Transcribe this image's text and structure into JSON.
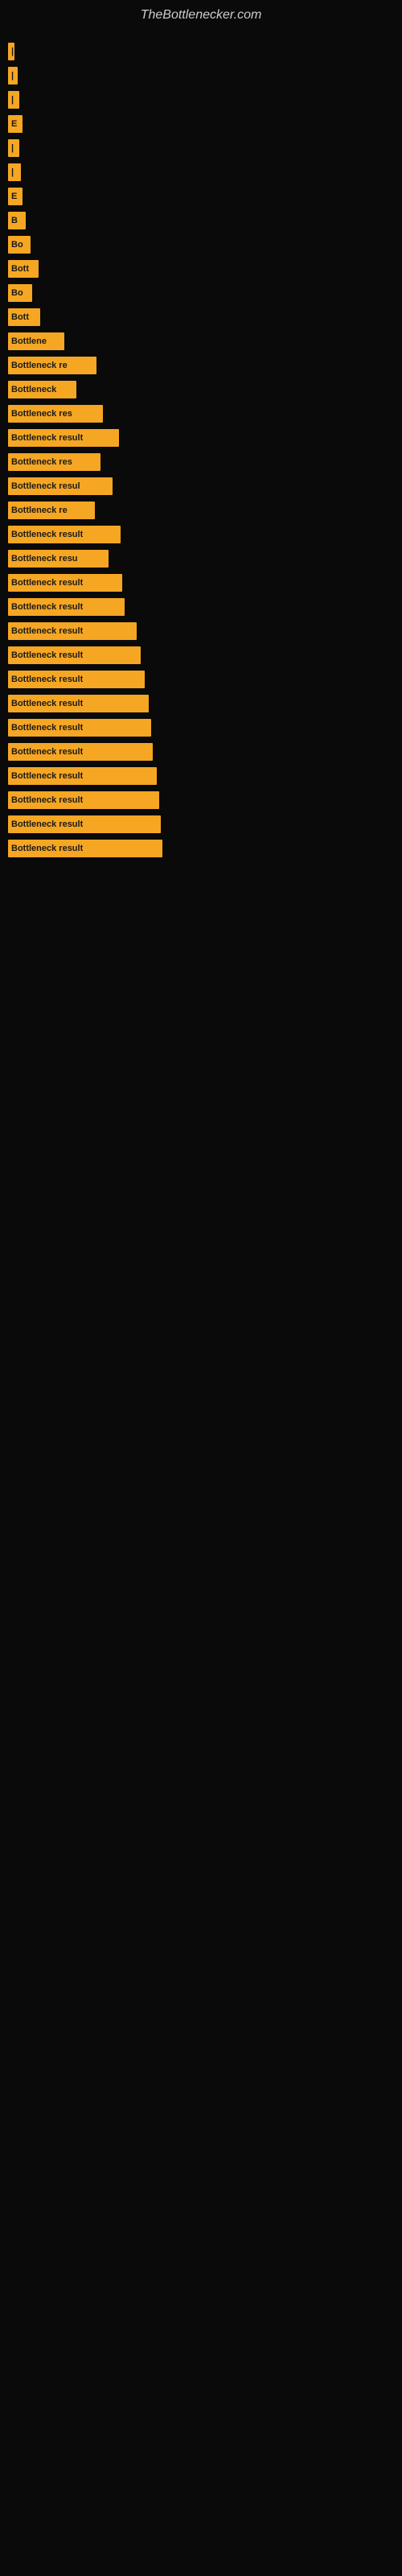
{
  "site": {
    "title": "TheBottlenecker.com"
  },
  "bars": [
    {
      "label": "|",
      "width": 8
    },
    {
      "label": "|",
      "width": 12
    },
    {
      "label": "|",
      "width": 14
    },
    {
      "label": "E",
      "width": 18
    },
    {
      "label": "|",
      "width": 14
    },
    {
      "label": "|",
      "width": 16
    },
    {
      "label": "E",
      "width": 18
    },
    {
      "label": "B",
      "width": 22
    },
    {
      "label": "Bo",
      "width": 28
    },
    {
      "label": "Bott",
      "width": 38
    },
    {
      "label": "Bo",
      "width": 30
    },
    {
      "label": "Bott",
      "width": 40
    },
    {
      "label": "Bottlene",
      "width": 70
    },
    {
      "label": "Bottleneck re",
      "width": 110
    },
    {
      "label": "Bottleneck",
      "width": 85
    },
    {
      "label": "Bottleneck res",
      "width": 118
    },
    {
      "label": "Bottleneck result",
      "width": 138
    },
    {
      "label": "Bottleneck res",
      "width": 115
    },
    {
      "label": "Bottleneck resul",
      "width": 130
    },
    {
      "label": "Bottleneck re",
      "width": 108
    },
    {
      "label": "Bottleneck result",
      "width": 140
    },
    {
      "label": "Bottleneck resu",
      "width": 125
    },
    {
      "label": "Bottleneck result",
      "width": 142
    },
    {
      "label": "Bottleneck result",
      "width": 145
    },
    {
      "label": "Bottleneck result",
      "width": 160
    },
    {
      "label": "Bottleneck result",
      "width": 165
    },
    {
      "label": "Bottleneck result",
      "width": 170
    },
    {
      "label": "Bottleneck result",
      "width": 175
    },
    {
      "label": "Bottleneck result",
      "width": 178
    },
    {
      "label": "Bottleneck result",
      "width": 180
    },
    {
      "label": "Bottleneck result",
      "width": 185
    },
    {
      "label": "Bottleneck result",
      "width": 188
    },
    {
      "label": "Bottleneck result",
      "width": 190
    },
    {
      "label": "Bottleneck result",
      "width": 192
    }
  ]
}
